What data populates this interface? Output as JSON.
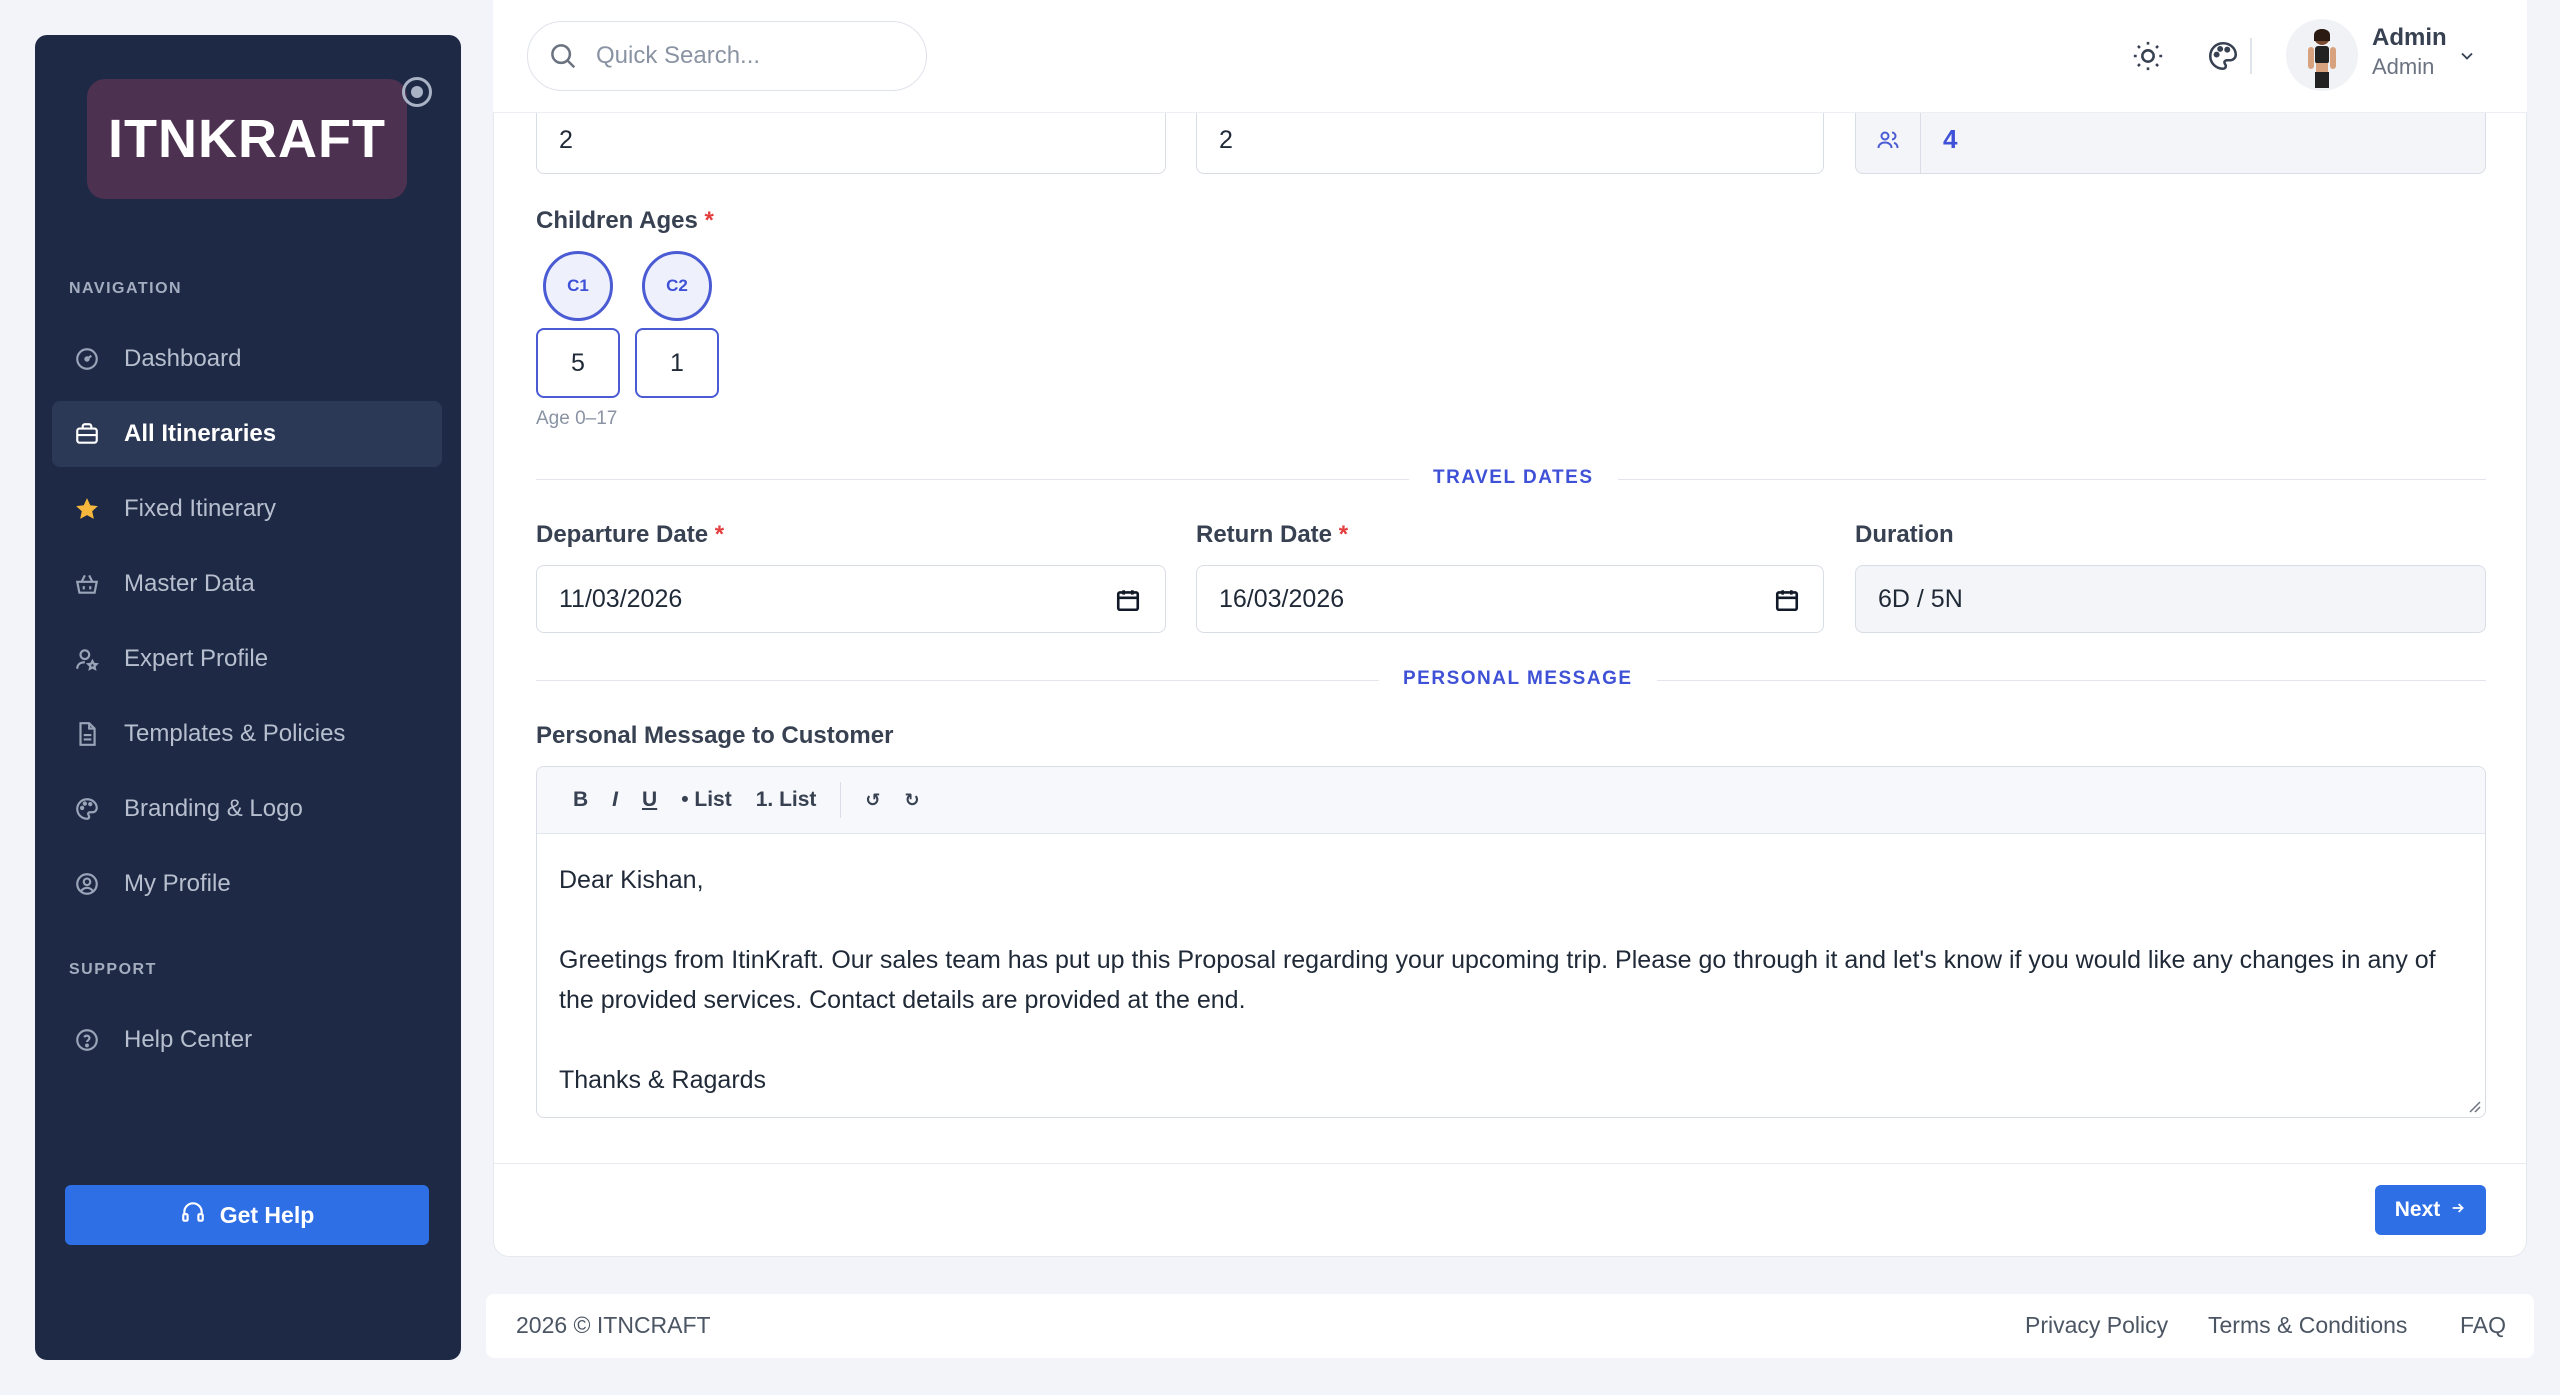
{
  "brand": {
    "logo_text": "ITNKRAFT"
  },
  "sidebar": {
    "nav_heading": "NAVIGATION",
    "support_heading": "SUPPORT",
    "items": [
      {
        "label": "Dashboard",
        "icon": "dashboard-gauge-icon"
      },
      {
        "label": "All Itineraries",
        "icon": "briefcase-icon",
        "active": true
      },
      {
        "label": "Fixed Itinerary",
        "icon": "star-icon"
      },
      {
        "label": "Master Data",
        "icon": "basket-icon"
      },
      {
        "label": "Expert Profile",
        "icon": "user-star-icon"
      },
      {
        "label": "Templates & Policies",
        "icon": "document-icon"
      },
      {
        "label": "Branding & Logo",
        "icon": "palette-icon"
      },
      {
        "label": "My Profile",
        "icon": "user-circle-icon"
      }
    ],
    "support_items": [
      {
        "label": "Help Center",
        "icon": "help-circle-icon"
      }
    ],
    "get_help_label": "Get Help"
  },
  "topbar": {
    "search_placeholder": "Quick Search...",
    "user_name": "Admin",
    "user_role": "Admin"
  },
  "form": {
    "adults_value": "2",
    "children_value": "2",
    "total_travelers": "4",
    "children_ages_label": "Children Ages",
    "children": [
      {
        "badge": "C1",
        "age": "5"
      },
      {
        "badge": "C2",
        "age": "1"
      }
    ],
    "age_hint": "Age 0–17",
    "travel_dates_title": "TRAVEL DATES",
    "departure_label": "Departure Date",
    "departure_value": "11/03/2026",
    "return_label": "Return Date",
    "return_value": "16/03/2026",
    "duration_label": "Duration",
    "duration_value": "6D / 5N",
    "personal_message_title": "PERSONAL MESSAGE",
    "message_label": "Personal Message to Customer",
    "toolbar": {
      "bold": "B",
      "italic": "I",
      "underline": "U",
      "bullet_list": "• List",
      "numbered_list": "1. List",
      "undo": "↺",
      "redo": "↻"
    },
    "message_lines": {
      "greeting": "Dear Kishan,",
      "body": "Greetings from ItinKraft. Our sales team has put up this Proposal regarding your upcoming trip. Please go through it and let's know if you would like any changes in any of the provided services. Contact details are provided at the end.",
      "closing": "Thanks & Ragards"
    },
    "next_label": "Next"
  },
  "footer": {
    "copyright": "2026 © ITNCRAFT",
    "links": [
      "Privacy Policy",
      "Terms & Conditions",
      "FAQ"
    ]
  },
  "colors": {
    "sidebar_bg": "#1e2a45",
    "accent": "#2f6fe6",
    "section_title": "#3f51d6",
    "required": "#e53e3e"
  }
}
